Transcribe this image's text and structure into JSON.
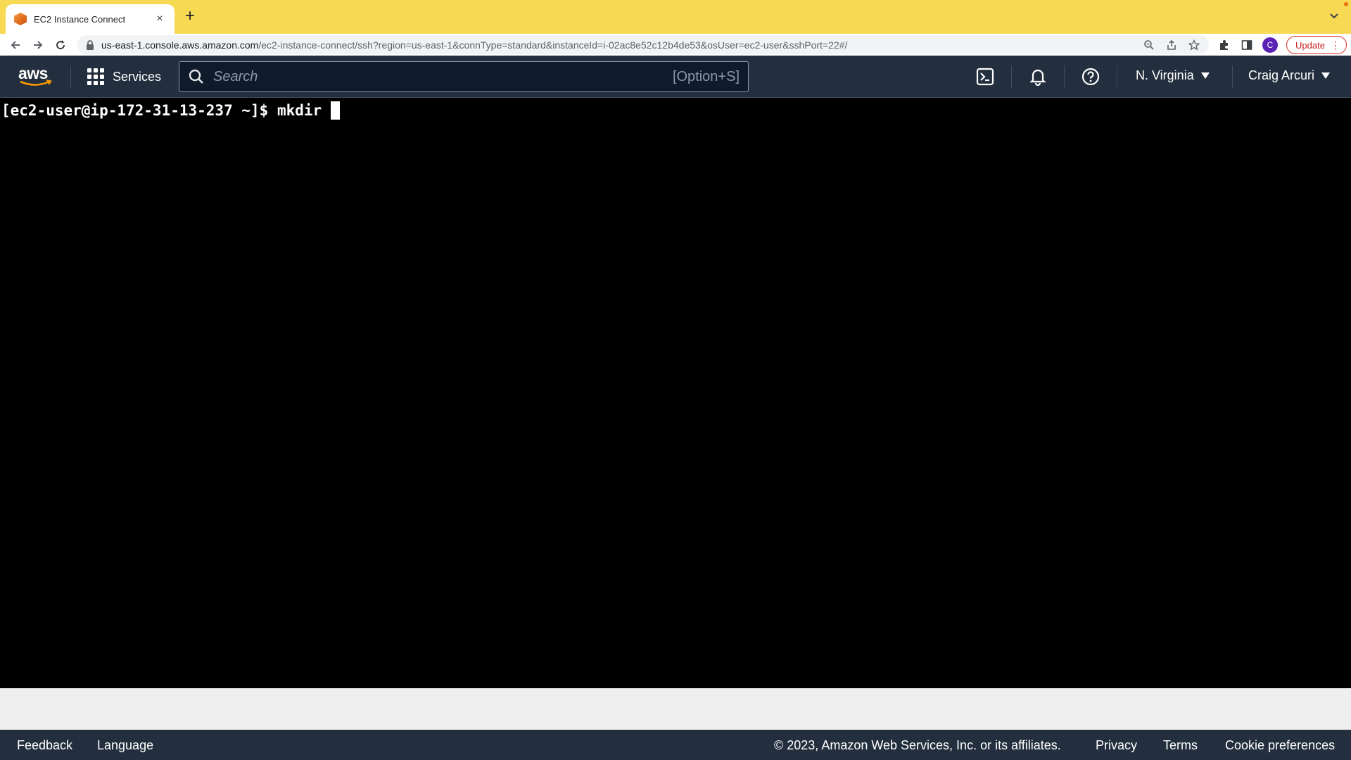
{
  "browser": {
    "tab": {
      "title": "EC2 Instance Connect",
      "close_glyph": "×",
      "favicon": "aws-cube-icon"
    },
    "new_tab_glyph": "+",
    "url_host": "us-east-1.console.aws.amazon.com",
    "url_path": "/ec2-instance-connect/ssh?region=us-east-1&connType=standard&instanceId=i-02ac8e52c12b4de53&osUser=ec2-user&sshPort=22#/",
    "profile_initial": "C",
    "update_label": "Update",
    "tab_strip_color": "#f7d954"
  },
  "aws_nav": {
    "logo_text": "aws",
    "services_label": "Services",
    "search": {
      "placeholder": "Search",
      "value": "",
      "shortcut": "[Option+S]"
    },
    "region_label": "N. Virginia",
    "account_label": "Craig Arcuri",
    "background": "#232f3e",
    "accent": "#ff9900"
  },
  "terminal": {
    "prompt": "[ec2-user@ip-172-31-13-237 ~]$ ",
    "command": "mkdir "
  },
  "footer": {
    "feedback": "Feedback",
    "language": "Language",
    "copyright": "© 2023, Amazon Web Services, Inc. or its affiliates.",
    "privacy": "Privacy",
    "terms": "Terms",
    "cookie_preferences": "Cookie preferences"
  }
}
